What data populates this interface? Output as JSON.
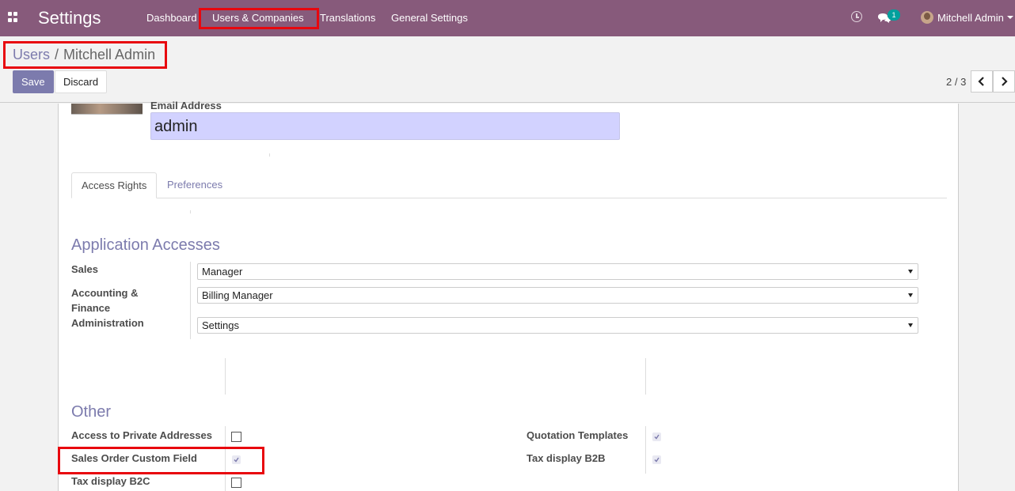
{
  "navbar": {
    "brand": "Settings",
    "menu": [
      "Dashboard",
      "Users & Companies",
      "Translations",
      "General Settings"
    ],
    "messages_count": "1",
    "user_name": "Mitchell Admin"
  },
  "breadcrumb": {
    "parent": "Users",
    "separator": "/",
    "current": "Mitchell Admin"
  },
  "buttons": {
    "save": "Save",
    "discard": "Discard"
  },
  "pager": {
    "value": "2 / 3"
  },
  "form": {
    "email_label": "Email Address",
    "email_value": "admin",
    "tabs": [
      "Access Rights",
      "Preferences"
    ],
    "active_tab": "Access Rights",
    "application_accesses": {
      "title": "Application Accesses",
      "fields": [
        {
          "label": "Sales",
          "value": "Manager"
        },
        {
          "label": "Accounting & Finance",
          "value": "Billing Manager"
        },
        {
          "label": "Administration",
          "value": "Settings"
        }
      ]
    },
    "other": {
      "title": "Other",
      "left": [
        {
          "label": "Access to Private Addresses",
          "checked": false
        },
        {
          "label": "Sales Order Custom Field",
          "checked": true
        },
        {
          "label": "Tax display B2C",
          "checked": false
        }
      ],
      "right": [
        {
          "label": "Quotation Templates",
          "checked": true
        },
        {
          "label": "Tax display B2B",
          "checked": true
        }
      ]
    }
  },
  "colors": {
    "navbar": "#875a7b",
    "accent": "#7c7bad",
    "highlight": "#e8070e",
    "email_field_bg": "#d2d2ff",
    "badge": "#00a09d"
  }
}
